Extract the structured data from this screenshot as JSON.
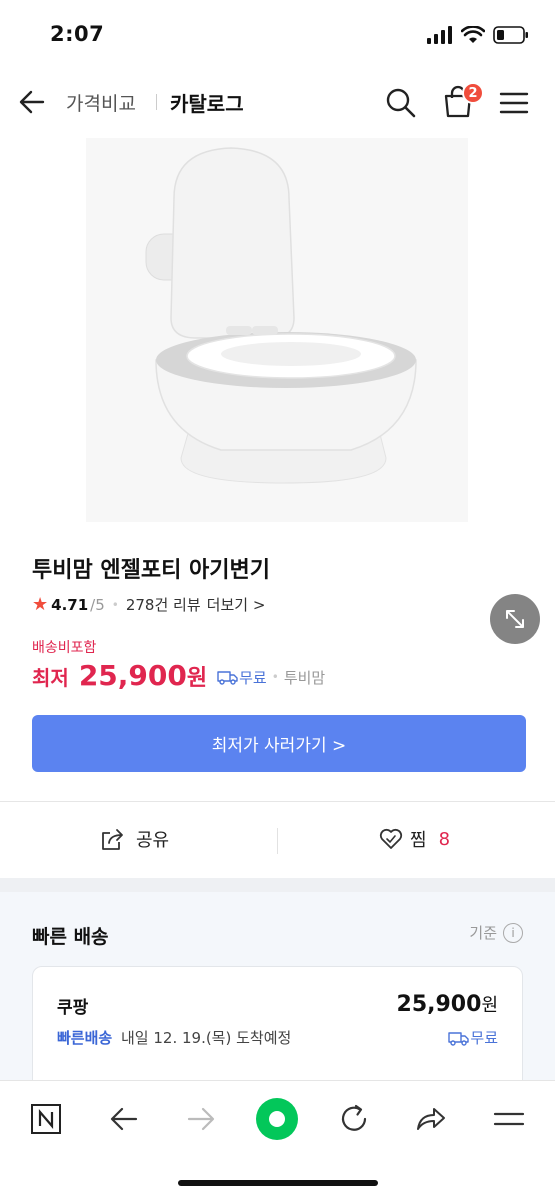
{
  "status": {
    "time": "2:07"
  },
  "header": {
    "compare_label": "가격비교",
    "catalog_label": "카탈로그",
    "cart_count": "2"
  },
  "product": {
    "title": "투비맘 엔젤포티 아기변기",
    "rating": "4.71",
    "rating_max": "/5",
    "review_count": "278건 리뷰",
    "review_more": "더보기 >",
    "shipping_included": "배송비포함",
    "price_prefix": "최저",
    "price": "25,900",
    "price_unit": "원",
    "shipping": "무료",
    "seller": "투비맘",
    "buy_button": "최저가 사러가기 >"
  },
  "actions": {
    "share_label": "공유",
    "like_label": "찜",
    "like_count": "8"
  },
  "fast_delivery": {
    "title": "빠른 배송",
    "criteria": "기준",
    "offer": {
      "store": "쿠팡",
      "price": "25,900",
      "price_unit": "원",
      "delivery_badge": "빠른배송",
      "delivery_text": "내일 12. 19.(목) 도착예정",
      "shipping": "무료"
    }
  },
  "colors": {
    "accent_red": "#e0264f",
    "button_blue": "#5b83f0",
    "link_blue": "#4a73d8",
    "badge_red": "#f04d3c",
    "naver_green": "#03c75a"
  },
  "icons": {
    "back": "arrow-left-icon",
    "search": "search-icon",
    "cart": "shopping-bag-icon",
    "menu": "hamburger-menu-icon",
    "zoom": "expand-icon",
    "share": "share-icon",
    "like": "heart-icon",
    "truck": "truck-icon"
  }
}
